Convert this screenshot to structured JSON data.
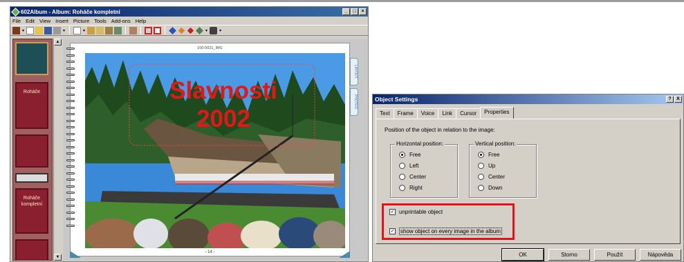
{
  "album_window": {
    "title": "602Album - Album: Roháče kompletní",
    "menu": [
      "File",
      "Edit",
      "View",
      "Insert",
      "Picture",
      "Tools",
      "Add-ons",
      "Help"
    ],
    "thumbnails": [
      "Roháče",
      "Roháče kompletní"
    ],
    "image_caption": "100-0021_IMG",
    "photo_title_line1": "Slavnosti",
    "photo_title_line2": "2002",
    "page_number": "- 14 -",
    "side_tabs": [
      "LAYOUT",
      "PHOTOS"
    ]
  },
  "dialog": {
    "title": "Object Settings",
    "help_btn": "?",
    "close_btn": "X",
    "tabs": [
      "Text",
      "Frame",
      "Voice",
      "Link",
      "Cursor",
      "Properties"
    ],
    "active_tab": "Properties",
    "description": "Position of the object in relation to the image:",
    "horizontal": {
      "title": "Horizontal position:",
      "options": [
        "Free",
        "Left",
        "Center",
        "Right"
      ],
      "selected": "Free"
    },
    "vertical": {
      "title": "Vertical position:",
      "options": [
        "Free",
        "Up",
        "Center",
        "Down"
      ],
      "selected": "Free"
    },
    "checkboxes": [
      {
        "label": "unprintable object",
        "checked": true
      },
      {
        "label": "show object on every image in the album",
        "checked": true
      }
    ],
    "buttons": [
      "OK",
      "Storno",
      "Použít",
      "Nápověda"
    ],
    "highlight_color": "#e4101a"
  }
}
